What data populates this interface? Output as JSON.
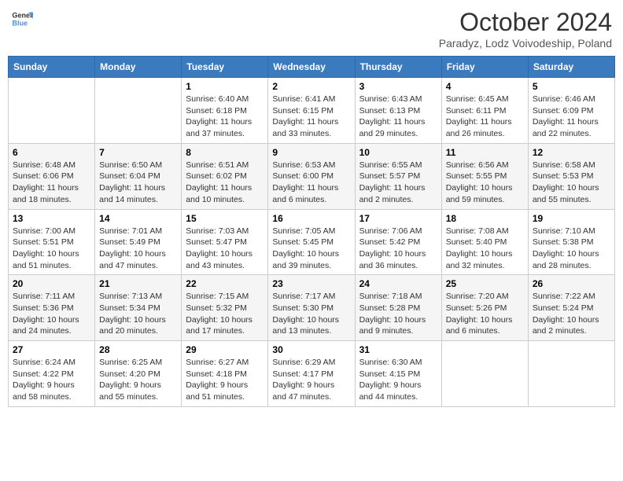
{
  "logo": {
    "line1": "General",
    "line2": "Blue"
  },
  "title": "October 2024",
  "subtitle": "Paradyz, Lodz Voivodeship, Poland",
  "days_of_week": [
    "Sunday",
    "Monday",
    "Tuesday",
    "Wednesday",
    "Thursday",
    "Friday",
    "Saturday"
  ],
  "weeks": [
    [
      {
        "day": "",
        "info": ""
      },
      {
        "day": "",
        "info": ""
      },
      {
        "day": "1",
        "info": "Sunrise: 6:40 AM\nSunset: 6:18 PM\nDaylight: 11 hours and 37 minutes."
      },
      {
        "day": "2",
        "info": "Sunrise: 6:41 AM\nSunset: 6:15 PM\nDaylight: 11 hours and 33 minutes."
      },
      {
        "day": "3",
        "info": "Sunrise: 6:43 AM\nSunset: 6:13 PM\nDaylight: 11 hours and 29 minutes."
      },
      {
        "day": "4",
        "info": "Sunrise: 6:45 AM\nSunset: 6:11 PM\nDaylight: 11 hours and 26 minutes."
      },
      {
        "day": "5",
        "info": "Sunrise: 6:46 AM\nSunset: 6:09 PM\nDaylight: 11 hours and 22 minutes."
      }
    ],
    [
      {
        "day": "6",
        "info": "Sunrise: 6:48 AM\nSunset: 6:06 PM\nDaylight: 11 hours and 18 minutes."
      },
      {
        "day": "7",
        "info": "Sunrise: 6:50 AM\nSunset: 6:04 PM\nDaylight: 11 hours and 14 minutes."
      },
      {
        "day": "8",
        "info": "Sunrise: 6:51 AM\nSunset: 6:02 PM\nDaylight: 11 hours and 10 minutes."
      },
      {
        "day": "9",
        "info": "Sunrise: 6:53 AM\nSunset: 6:00 PM\nDaylight: 11 hours and 6 minutes."
      },
      {
        "day": "10",
        "info": "Sunrise: 6:55 AM\nSunset: 5:57 PM\nDaylight: 11 hours and 2 minutes."
      },
      {
        "day": "11",
        "info": "Sunrise: 6:56 AM\nSunset: 5:55 PM\nDaylight: 10 hours and 59 minutes."
      },
      {
        "day": "12",
        "info": "Sunrise: 6:58 AM\nSunset: 5:53 PM\nDaylight: 10 hours and 55 minutes."
      }
    ],
    [
      {
        "day": "13",
        "info": "Sunrise: 7:00 AM\nSunset: 5:51 PM\nDaylight: 10 hours and 51 minutes."
      },
      {
        "day": "14",
        "info": "Sunrise: 7:01 AM\nSunset: 5:49 PM\nDaylight: 10 hours and 47 minutes."
      },
      {
        "day": "15",
        "info": "Sunrise: 7:03 AM\nSunset: 5:47 PM\nDaylight: 10 hours and 43 minutes."
      },
      {
        "day": "16",
        "info": "Sunrise: 7:05 AM\nSunset: 5:45 PM\nDaylight: 10 hours and 39 minutes."
      },
      {
        "day": "17",
        "info": "Sunrise: 7:06 AM\nSunset: 5:42 PM\nDaylight: 10 hours and 36 minutes."
      },
      {
        "day": "18",
        "info": "Sunrise: 7:08 AM\nSunset: 5:40 PM\nDaylight: 10 hours and 32 minutes."
      },
      {
        "day": "19",
        "info": "Sunrise: 7:10 AM\nSunset: 5:38 PM\nDaylight: 10 hours and 28 minutes."
      }
    ],
    [
      {
        "day": "20",
        "info": "Sunrise: 7:11 AM\nSunset: 5:36 PM\nDaylight: 10 hours and 24 minutes."
      },
      {
        "day": "21",
        "info": "Sunrise: 7:13 AM\nSunset: 5:34 PM\nDaylight: 10 hours and 20 minutes."
      },
      {
        "day": "22",
        "info": "Sunrise: 7:15 AM\nSunset: 5:32 PM\nDaylight: 10 hours and 17 minutes."
      },
      {
        "day": "23",
        "info": "Sunrise: 7:17 AM\nSunset: 5:30 PM\nDaylight: 10 hours and 13 minutes."
      },
      {
        "day": "24",
        "info": "Sunrise: 7:18 AM\nSunset: 5:28 PM\nDaylight: 10 hours and 9 minutes."
      },
      {
        "day": "25",
        "info": "Sunrise: 7:20 AM\nSunset: 5:26 PM\nDaylight: 10 hours and 6 minutes."
      },
      {
        "day": "26",
        "info": "Sunrise: 7:22 AM\nSunset: 5:24 PM\nDaylight: 10 hours and 2 minutes."
      }
    ],
    [
      {
        "day": "27",
        "info": "Sunrise: 6:24 AM\nSunset: 4:22 PM\nDaylight: 9 hours and 58 minutes."
      },
      {
        "day": "28",
        "info": "Sunrise: 6:25 AM\nSunset: 4:20 PM\nDaylight: 9 hours and 55 minutes."
      },
      {
        "day": "29",
        "info": "Sunrise: 6:27 AM\nSunset: 4:18 PM\nDaylight: 9 hours and 51 minutes."
      },
      {
        "day": "30",
        "info": "Sunrise: 6:29 AM\nSunset: 4:17 PM\nDaylight: 9 hours and 47 minutes."
      },
      {
        "day": "31",
        "info": "Sunrise: 6:30 AM\nSunset: 4:15 PM\nDaylight: 9 hours and 44 minutes."
      },
      {
        "day": "",
        "info": ""
      },
      {
        "day": "",
        "info": ""
      }
    ]
  ]
}
